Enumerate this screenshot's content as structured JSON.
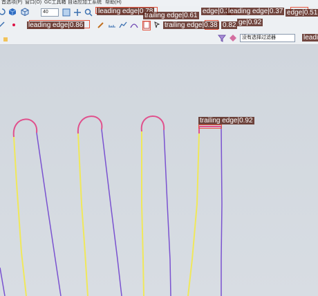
{
  "menubar": {
    "items": [
      "首选项(P)",
      "窗口(O)",
      "GC工具箱",
      "自适应加工系统",
      "帮助(H)"
    ]
  },
  "toolbar": {
    "zoom_value": "40",
    "filter_value": "没有选择过滤器"
  },
  "annotations": [
    {
      "text": "leading edge|0.78"
    },
    {
      "text": "trailing edge|0.61"
    },
    {
      "text": "edge|0.3"
    },
    {
      "text": "leading edge|0.37"
    },
    {
      "text": "edge|0.51"
    },
    {
      "text": "leading edge|0.86"
    },
    {
      "text": "trailing edge|0.38"
    },
    {
      "text": "0.82"
    },
    {
      "text": "ge|0.92"
    },
    {
      "text": "leadi"
    },
    {
      "text": "trailing edge|0.92"
    }
  ],
  "colors": {
    "leading_edge": "#f0e85a",
    "trailing_edge": "#7a52d0",
    "tip": "#e0508c",
    "label_bg": "#5a281e",
    "box_outline": "#e5533c"
  }
}
